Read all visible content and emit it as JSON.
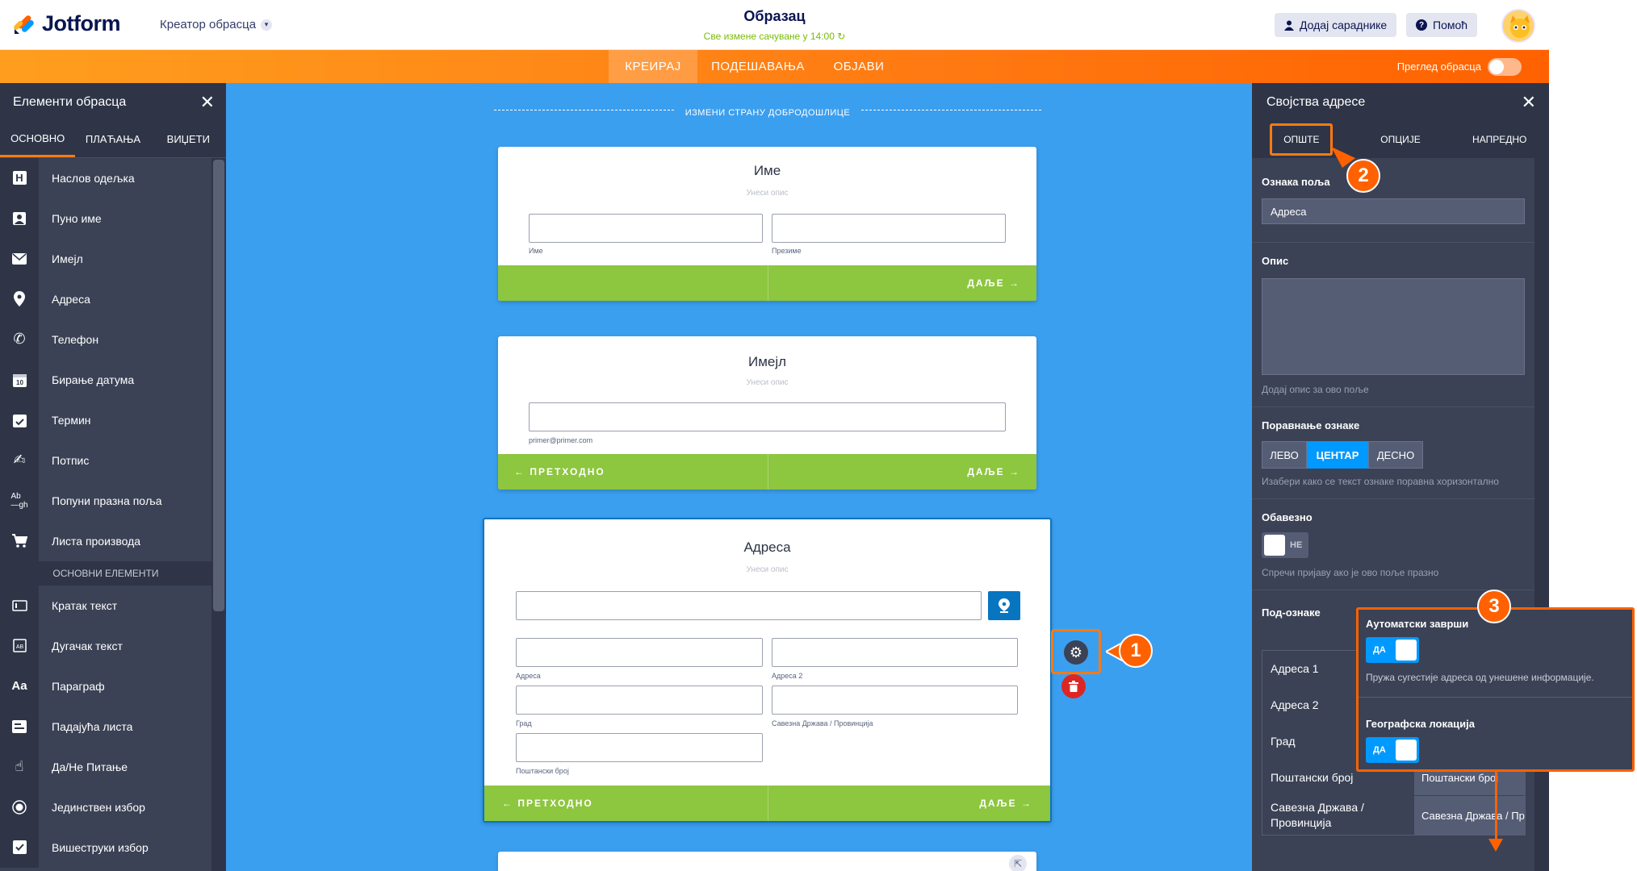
{
  "app": {
    "brand": "Jotform",
    "creator_label": "Креатор обрасца",
    "form_title": "Образац",
    "saved_status": "Све измене сачуване у 14:00",
    "add_collaborators": "Додај сараднике",
    "help": "Помоћ"
  },
  "nav": {
    "tabs": [
      {
        "label": "КРЕИРАЈ",
        "active": true
      },
      {
        "label": "ПОДЕШАВАЊА",
        "active": false
      },
      {
        "label": "ОБЈАВИ",
        "active": false
      }
    ],
    "preview_label": "Преглед обрасца"
  },
  "left_panel": {
    "title": "Елементи обрасца",
    "tabs": [
      "ОСНОВНО",
      "ПЛАЋАЊА",
      "ВИЏЕТИ"
    ],
    "items": [
      {
        "icon": "heading-icon",
        "label": "Наслов одељка"
      },
      {
        "icon": "user-icon",
        "label": "Пуно име"
      },
      {
        "icon": "envelope-icon",
        "label": "Имејл"
      },
      {
        "icon": "map-pin-icon",
        "label": "Адреса"
      },
      {
        "icon": "phone-icon",
        "label": "Телефон"
      },
      {
        "icon": "calendar-icon",
        "label": "Бирање датума"
      },
      {
        "icon": "calendar-check-icon",
        "label": "Термин"
      },
      {
        "icon": "signature-icon",
        "label": "Потпис"
      },
      {
        "icon": "fill-blank-icon",
        "label": "Попуни празна поља"
      },
      {
        "icon": "cart-icon",
        "label": "Листа производа"
      }
    ],
    "section_label": "ОСНОВНИ ЕЛЕМЕНТИ",
    "basic_items": [
      {
        "icon": "short-text-icon",
        "label": "Кратак текст"
      },
      {
        "icon": "long-text-icon",
        "label": "Дугачак текст"
      },
      {
        "icon": "paragraph-icon",
        "label": "Параграф"
      },
      {
        "icon": "dropdown-icon",
        "label": "Падајућа листа"
      },
      {
        "icon": "yes-no-icon",
        "label": "Да/Не Питање"
      },
      {
        "icon": "radio-icon",
        "label": "Јединствен избор"
      },
      {
        "icon": "checkbox-icon",
        "label": "Вишеструки избор"
      }
    ]
  },
  "canvas": {
    "welcome_label": "ИЗМЕНИ СТРАНУ ДОБРОДОШЛИЦЕ",
    "cards": {
      "name": {
        "title": "Име",
        "desc": "Унеси опис",
        "sub_first": "Име",
        "sub_last": "Презиме",
        "next": "ДАЉЕ"
      },
      "email": {
        "title": "Имејл",
        "desc": "Унеси опис",
        "sub": "primer@primer.com",
        "prev": "ПРЕТХОДНО",
        "next": "ДАЉЕ"
      },
      "address": {
        "title": "Адреса",
        "desc": "Унеси опис",
        "sub_addr1": "Адреса",
        "sub_addr2": "Адреса 2",
        "sub_city": "Град",
        "sub_state": "Савезна Држава / Провинција",
        "sub_zip": "Поштански број",
        "prev": "ПРЕТХОДНО",
        "next": "ДАЉЕ"
      }
    }
  },
  "right_panel": {
    "title": "Својства адресе",
    "tabs": [
      "ОПШТЕ",
      "ОПЦИЈЕ",
      "НАПРЕДНО"
    ],
    "field_label_title": "Ознака поља",
    "field_label_value": "Адреса",
    "description_title": "Опис",
    "description_hint": "Додај опис за ово поље",
    "alignment_title": "Поравнање ознаке",
    "alignment_options": [
      "ЛЕВО",
      "ЦЕНТАР",
      "ДЕСНО"
    ],
    "alignment_selected": "ЦЕНТАР",
    "alignment_hint": "Изабери како се текст ознаке поравна хоризонтално",
    "required_title": "Обавезно",
    "required_toggle": "НЕ",
    "required_hint": "Спречи пријаву ако је ово поље празно",
    "sublabels_title": "Под-ознаке",
    "sublabels": [
      {
        "name": "Адреса 1",
        "value": ""
      },
      {
        "name": "Адреса 2",
        "value": ""
      },
      {
        "name": "Град",
        "value": ""
      },
      {
        "name": "Поштански број",
        "value": "Поштански број"
      },
      {
        "name": "Савезна Држава / Провинција",
        "value": "Савезна Држава / Пр"
      }
    ]
  },
  "overlay": {
    "autocomplete_title": "Аутоматски заврши",
    "autocomplete_toggle": "ДА",
    "autocomplete_hint": "Пружа сугестије адреса од унешене информације.",
    "geolocation_title": "Географска локација",
    "geolocation_toggle": "ДА"
  },
  "annotations": {
    "step1": "1",
    "step2": "2",
    "step3": "3"
  },
  "colors": {
    "accent": "#ff6100",
    "canvas": "#3b9ff0",
    "panel": "#3b4255",
    "button_green": "#8dc63f",
    "toggle_on": "#0099ff"
  }
}
